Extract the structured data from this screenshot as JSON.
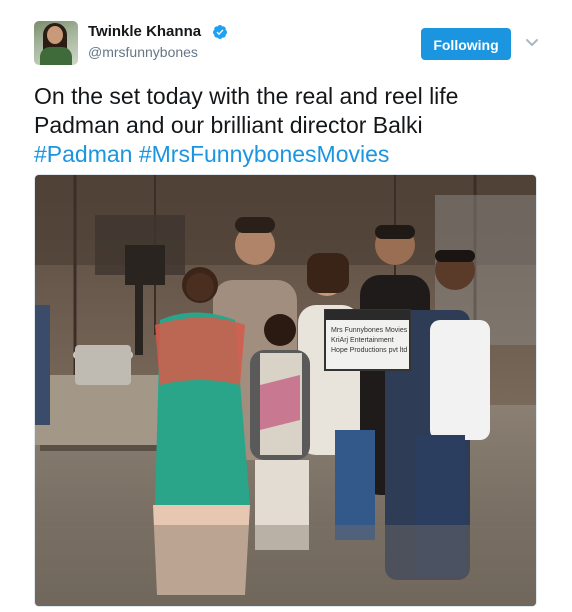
{
  "tweet": {
    "author": {
      "display_name": "Twinkle Khanna",
      "handle": "@mrsfunnybones",
      "verified": true,
      "avatar_icon": "profile-photo"
    },
    "follow_button_label": "Following",
    "more_options_icon": "chevron-down-icon",
    "text_line_1": "On the set today with the real and reel life",
    "text_line_2": "Padman and our brilliant director Balki",
    "hashtags": [
      "#Padman",
      "#MrsFunnybonesMovies"
    ],
    "photo": {
      "alt": "Group photo on a film set with a clapperboard",
      "clapperboard_text": [
        "Mrs Funnybones Movies",
        "KriArj Entertainment",
        "Hope Productions pvt ltd"
      ]
    }
  },
  "colors": {
    "accent": "#1b95e0",
    "text": "#14171a",
    "secondary_text": "#657786"
  }
}
